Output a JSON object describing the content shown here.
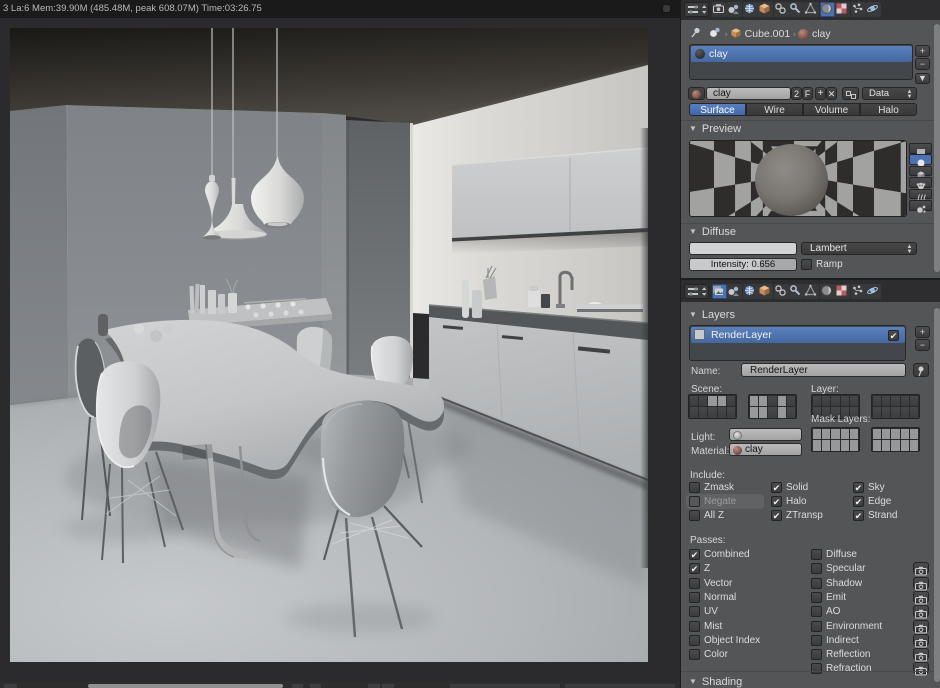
{
  "topbar": {
    "stats": "3 La:6 Mem:39.90M (485.48M, peak 608.07M) Time:03:26.75"
  },
  "material_panel": {
    "tab_icons": [
      "render",
      "scene",
      "world",
      "object",
      "constraints",
      "modifiers",
      "object-data",
      "material",
      "texture",
      "particles",
      "physics"
    ],
    "selected_tab": "material",
    "breadcrumb": {
      "object": "Cube.001",
      "material": "clay"
    },
    "slot_list": {
      "items": [
        "clay"
      ],
      "selected": "clay"
    },
    "datablock": {
      "name": "clay",
      "users": "2",
      "fake_user": "F",
      "source": "Data"
    },
    "type_tabs": {
      "items": [
        "Surface",
        "Wire",
        "Volume",
        "Halo"
      ],
      "active": "Surface"
    },
    "preview_header": "Preview",
    "diffuse": {
      "header": "Diffuse",
      "color": "#d2d3d4",
      "shader": "Lambert",
      "intensity_label": "Intensity: 0.656",
      "intensity_value": 0.656,
      "ramp_label": "Ramp",
      "ramp_checked": false
    }
  },
  "layers_panel": {
    "tab_icons": [
      "render-layers",
      "scene",
      "world",
      "object",
      "constraints",
      "modifiers",
      "object-data",
      "material",
      "texture",
      "particles",
      "physics"
    ],
    "selected_tab": "render-layers",
    "header": "Layers",
    "list": {
      "items": [
        "RenderLayer"
      ],
      "selected": "RenderLayer",
      "selected_checked": true
    },
    "name_label": "Name:",
    "name_value": "RenderLayer",
    "scene_label": "Scene:",
    "layer_label": "Layer:",
    "mask_label": "Mask Layers:",
    "light_label": "Light:",
    "light_value": "",
    "material_label": "Material:",
    "material_value": "clay",
    "scene_grids": [
      [
        0,
        0,
        1,
        1,
        0,
        0,
        0,
        0,
        0,
        0
      ],
      [
        1,
        1,
        0,
        1,
        0,
        1,
        1,
        0,
        1,
        0
      ]
    ],
    "layer_grids": [
      [
        0,
        0,
        0,
        0,
        0,
        0,
        0,
        0,
        0,
        0
      ],
      [
        0,
        0,
        0,
        0,
        0,
        0,
        0,
        0,
        0,
        0
      ]
    ],
    "mask_grids": [
      [
        2,
        2,
        2,
        2,
        2,
        2,
        2,
        2,
        2,
        2
      ],
      [
        2,
        2,
        2,
        2,
        2,
        2,
        2,
        2,
        2,
        2
      ]
    ],
    "include": {
      "header": "Include:",
      "columns": [
        [
          {
            "label": "Zmask",
            "checked": false,
            "disabled": false
          },
          {
            "label": "Negate",
            "checked": false,
            "disabled": true
          },
          {
            "label": "All Z",
            "checked": false,
            "disabled": false
          }
        ],
        [
          {
            "label": "Solid",
            "checked": true
          },
          {
            "label": "Halo",
            "checked": true
          },
          {
            "label": "ZTransp",
            "checked": true
          }
        ],
        [
          {
            "label": "Sky",
            "checked": true
          },
          {
            "label": "Edge",
            "checked": true
          },
          {
            "label": "Strand",
            "checked": true
          }
        ]
      ]
    },
    "passes": {
      "header": "Passes:",
      "col1": [
        {
          "label": "Combined",
          "checked": true
        },
        {
          "label": "Z",
          "checked": true
        },
        {
          "label": "Vector",
          "checked": false
        },
        {
          "label": "Normal",
          "checked": false
        },
        {
          "label": "UV",
          "checked": false
        },
        {
          "label": "Mist",
          "checked": false
        },
        {
          "label": "Object Index",
          "checked": false
        },
        {
          "label": "Color",
          "checked": false
        }
      ],
      "col2": [
        {
          "label": "Diffuse",
          "checked": false,
          "btn": false
        },
        {
          "label": "Specular",
          "checked": false,
          "btn": true
        },
        {
          "label": "Shadow",
          "checked": false,
          "btn": true
        },
        {
          "label": "Emit",
          "checked": false,
          "btn": true
        },
        {
          "label": "AO",
          "checked": false,
          "btn": true
        },
        {
          "label": "Environment",
          "checked": false,
          "btn": true
        },
        {
          "label": "Indirect",
          "checked": false,
          "btn": true
        },
        {
          "label": "Reflection",
          "checked": false,
          "btn": true
        },
        {
          "label": "Refraction",
          "checked": false,
          "btn": true
        }
      ]
    }
  },
  "shading_header": "Shading"
}
